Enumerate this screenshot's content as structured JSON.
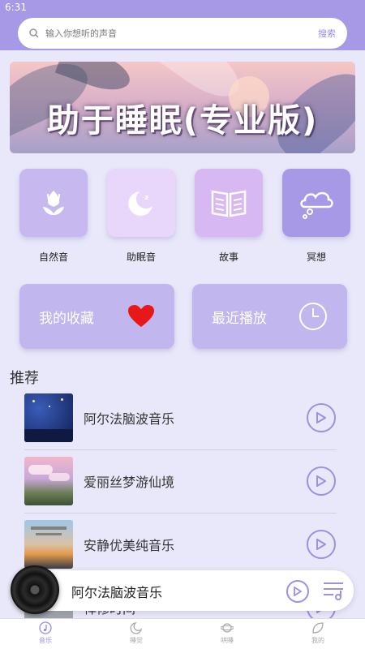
{
  "status": {
    "time": "6:31"
  },
  "search": {
    "placeholder": "输入你想听的声音",
    "button": "搜索"
  },
  "banner": {
    "title": "助于睡眠(专业版)"
  },
  "categories": [
    {
      "label": "自然音",
      "icon": "tulip-icon",
      "color": "#c7b9f0"
    },
    {
      "label": "助眠音",
      "icon": "moon-icon",
      "color": "#e8d6fb"
    },
    {
      "label": "故事",
      "icon": "book-icon",
      "color": "#d8b8f3"
    },
    {
      "label": "冥想",
      "icon": "cloud-icon",
      "color": "#a899e6"
    }
  ],
  "cards": {
    "favorites": "我的收藏",
    "recent": "最近播放"
  },
  "recommend": {
    "title": "推荐",
    "items": [
      {
        "name": "阿尔法脑波音乐"
      },
      {
        "name": "爱丽丝梦游仙境"
      },
      {
        "name": "安静优美纯音乐"
      },
      {
        "name": "禅修时间"
      }
    ]
  },
  "player": {
    "now_playing": "阿尔法脑波音乐"
  },
  "tabs": [
    {
      "label": "音乐",
      "icon": "music-note-icon",
      "active": true
    },
    {
      "label": "睡觉",
      "icon": "moon-icon",
      "active": false
    },
    {
      "label": "哄睡",
      "icon": "planet-icon",
      "active": false
    },
    {
      "label": "我的",
      "icon": "leaf-icon",
      "active": false
    }
  ],
  "colors": {
    "accent": "#a899e6",
    "background": "#e8e8fa",
    "card": "#c1b6ee",
    "heart": "#e81818"
  }
}
